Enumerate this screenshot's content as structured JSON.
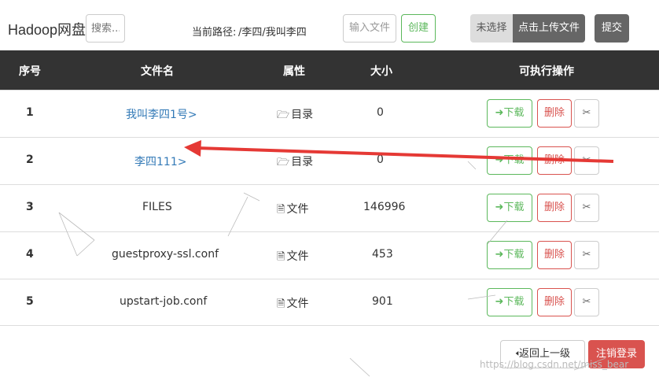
{
  "header": {
    "brand": "Hadoop网盘",
    "search_placeholder": "搜索...",
    "path_label": "当前路径:",
    "path_value": "/李四/我叫李四",
    "file_input_placeholder": "输入文件",
    "create_label": "创建",
    "file_chosen_text": "未选择",
    "upload_label": "点击上传文件",
    "submit_label": "提交"
  },
  "table": {
    "headers": [
      "序号",
      "文件名",
      "属性",
      "大小",
      "可执行操作"
    ],
    "rows": [
      {
        "index": "1",
        "name": "我叫李四1号>",
        "type": "目录",
        "size": "0",
        "is_dir": true
      },
      {
        "index": "2",
        "name": "李四111>",
        "type": "目录",
        "size": "0",
        "is_dir": true
      },
      {
        "index": "3",
        "name": "FILES",
        "type": "文件",
        "size": "146996",
        "is_dir": false
      },
      {
        "index": "4",
        "name": "guestproxy-ssl.conf",
        "type": "文件",
        "size": "453",
        "is_dir": false
      },
      {
        "index": "5",
        "name": "upstart-job.conf",
        "type": "文件",
        "size": "901",
        "is_dir": false
      }
    ],
    "actions": {
      "download_label": "下载",
      "delete_label": "删除",
      "cut_icon": "scissors-icon",
      "download_icon": "sign-in-icon",
      "dir_icon": "folder-open-icon",
      "file_icon": "file-text-icon"
    }
  },
  "footer": {
    "back_label": "返回上一级",
    "logout_label": "注销登录",
    "back_icon": "arrow-left-icon"
  },
  "watermark": "https://blog.csdn.net/miss_bear",
  "colors": {
    "header_bg": "#333333",
    "link": "#337ab7",
    "success": "#5cb85c",
    "danger": "#d9534f",
    "annotation_arrow": "#e53935"
  }
}
